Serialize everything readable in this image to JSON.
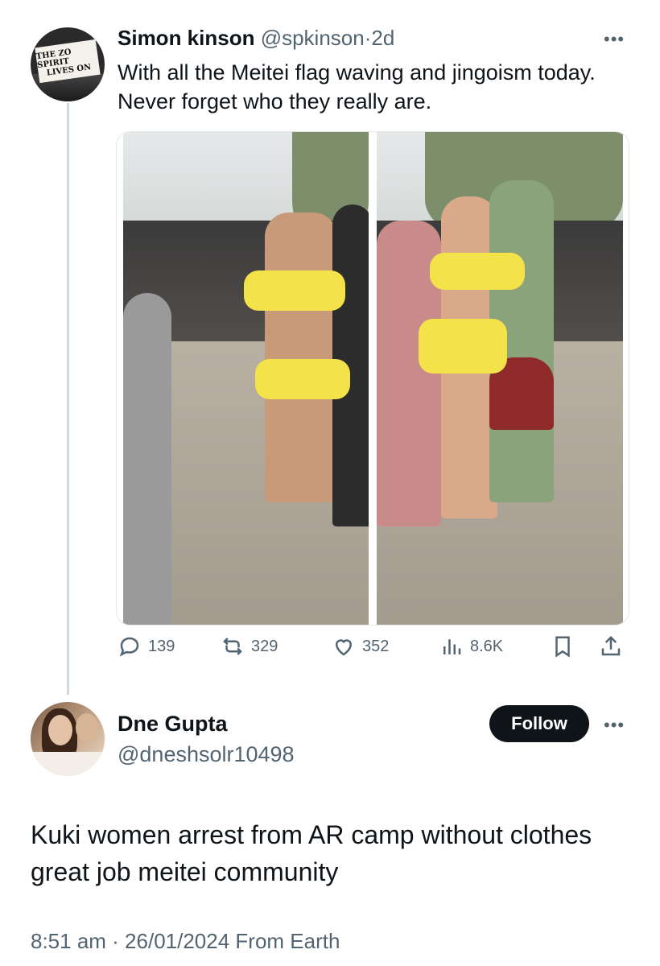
{
  "tweet1": {
    "author_name": "Simon kinson",
    "handle": "@spkinson",
    "separator": "·",
    "age": "2d",
    "text": "With all the Meitei flag waving and jingoism today. Never forget who they really are.",
    "avatar_sign_line1": "THE ZO SPIRIT",
    "avatar_sign_line2": "LIVES ON",
    "more_icon": "more-horizontal-icon",
    "stats": {
      "replies": "139",
      "reposts": "329",
      "likes": "352",
      "views": "8.6K"
    }
  },
  "tweet2": {
    "author_name": "Dne Gupta",
    "handle": "@dneshsolr10498",
    "follow_label": "Follow",
    "text": "Kuki women arrest from AR camp without clothes great job meitei community",
    "timestamp": "8:51 am · 26/01/2024 From Earth"
  },
  "colors": {
    "text_primary": "#0f1419",
    "text_secondary": "#536471",
    "thread_line": "#cfd9de",
    "follow_bg": "#0f1419",
    "censor_bar": "#f4e24a"
  }
}
